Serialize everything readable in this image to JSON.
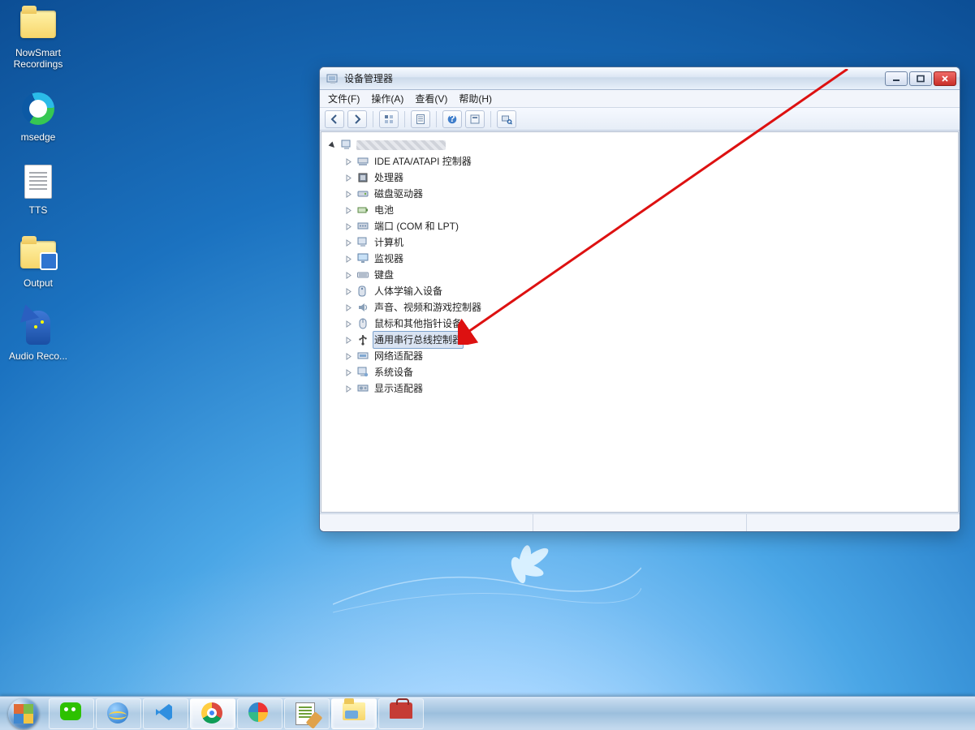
{
  "desktop": {
    "icons": [
      {
        "id": "nowsmart-recordings",
        "label": "NowSmart Recordings",
        "graphic": "folder"
      },
      {
        "id": "msedge",
        "label": "msedge",
        "graphic": "edge"
      },
      {
        "id": "tts",
        "label": "TTS",
        "graphic": "text"
      },
      {
        "id": "output",
        "label": "Output",
        "graphic": "folder-badge"
      },
      {
        "id": "audio-reco",
        "label": "Audio Reco...",
        "graphic": "wizard"
      }
    ]
  },
  "window": {
    "title": "设备管理器",
    "menus": [
      {
        "id": "file",
        "label": "文件(F)"
      },
      {
        "id": "action",
        "label": "操作(A)"
      },
      {
        "id": "view",
        "label": "查看(V)"
      },
      {
        "id": "help",
        "label": "帮助(H)"
      }
    ],
    "toolbar": [
      {
        "id": "back",
        "icon": "arrow-left"
      },
      {
        "id": "forward",
        "icon": "arrow-right"
      },
      {
        "id": "sep1",
        "icon": "sep"
      },
      {
        "id": "show-tree",
        "icon": "tree"
      },
      {
        "id": "sep2",
        "icon": "sep"
      },
      {
        "id": "properties",
        "icon": "props"
      },
      {
        "id": "sep3",
        "icon": "sep"
      },
      {
        "id": "help-btn",
        "icon": "help"
      },
      {
        "id": "filter",
        "icon": "filter"
      },
      {
        "id": "sep4",
        "icon": "sep"
      },
      {
        "id": "scan",
        "icon": "scan"
      }
    ],
    "root_label_redacted": true,
    "categories": [
      {
        "id": "ide",
        "label": "IDE ATA/ATAPI 控制器",
        "icon": "ide"
      },
      {
        "id": "cpu",
        "label": "处理器",
        "icon": "cpu"
      },
      {
        "id": "disk",
        "label": "磁盘驱动器",
        "icon": "disk"
      },
      {
        "id": "battery",
        "label": "电池",
        "icon": "battery"
      },
      {
        "id": "ports",
        "label": "端口 (COM 和 LPT)",
        "icon": "port"
      },
      {
        "id": "computer",
        "label": "计算机",
        "icon": "pc"
      },
      {
        "id": "monitor",
        "label": "监视器",
        "icon": "monitor"
      },
      {
        "id": "keyboard",
        "label": "键盘",
        "icon": "keyboard"
      },
      {
        "id": "hid",
        "label": "人体学输入设备",
        "icon": "hid"
      },
      {
        "id": "sound",
        "label": "声音、视频和游戏控制器",
        "icon": "sound"
      },
      {
        "id": "mouse",
        "label": "鼠标和其他指针设备",
        "icon": "mouse"
      },
      {
        "id": "usb",
        "label": "通用串行总线控制器",
        "icon": "usb",
        "selected": true
      },
      {
        "id": "network",
        "label": "网络适配器",
        "icon": "net"
      },
      {
        "id": "system",
        "label": "系统设备",
        "icon": "sys"
      },
      {
        "id": "display",
        "label": "显示适配器",
        "icon": "gpu"
      }
    ]
  },
  "taskbar": {
    "items": [
      {
        "id": "wechat",
        "icon": "wechat",
        "active": false
      },
      {
        "id": "ie",
        "icon": "ie",
        "active": false
      },
      {
        "id": "vscode",
        "icon": "vscode",
        "active": false
      },
      {
        "id": "chrome",
        "icon": "chrome",
        "active": true
      },
      {
        "id": "beachball",
        "icon": "bea",
        "active": false
      },
      {
        "id": "notepadpp",
        "icon": "notepp",
        "active": false
      },
      {
        "id": "explorer",
        "icon": "explorer",
        "active": true
      },
      {
        "id": "toolbox",
        "icon": "toolbox",
        "active": false
      }
    ]
  }
}
